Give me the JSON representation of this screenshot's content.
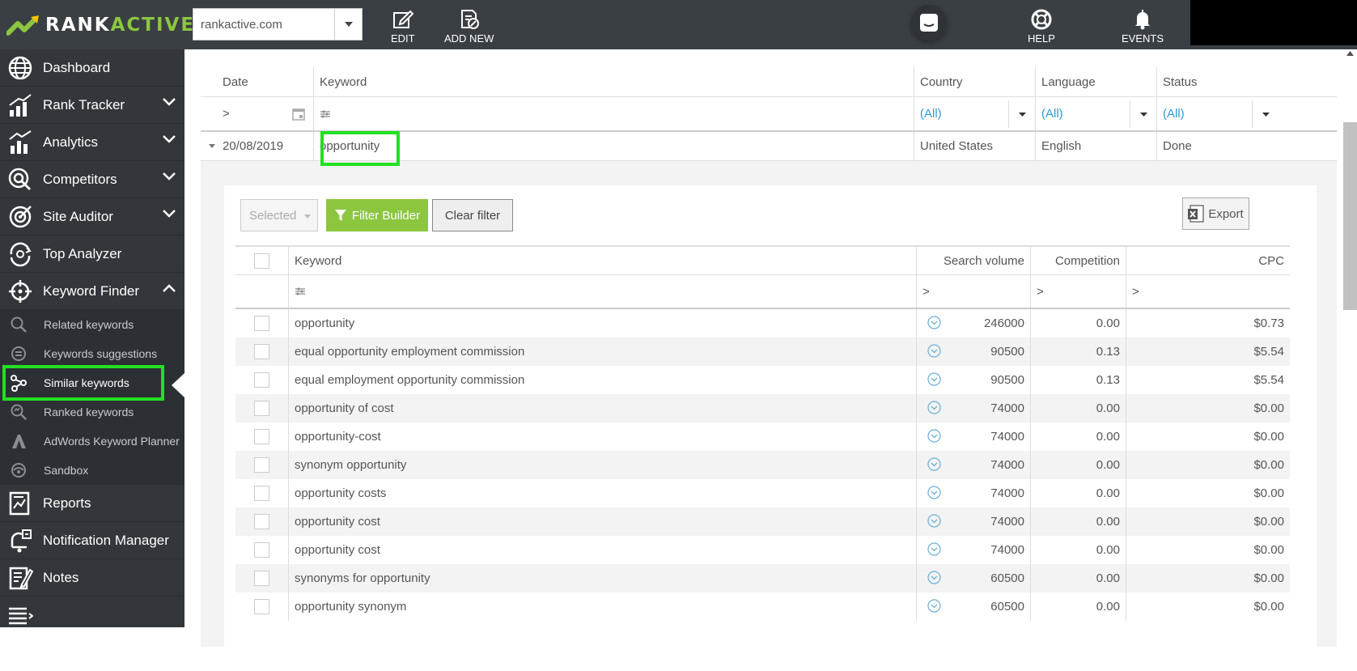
{
  "brand": {
    "rank": "RANK",
    "active": "ACTIVE"
  },
  "topbar": {
    "domain_value": "rankactive.com",
    "edit_label": "EDIT",
    "add_new_label": "ADD NEW",
    "help_label": "HELP",
    "events_label": "EVENTS"
  },
  "sidebar": {
    "items": [
      {
        "label": "Dashboard"
      },
      {
        "label": "Rank Tracker"
      },
      {
        "label": "Analytics"
      },
      {
        "label": "Competitors"
      },
      {
        "label": "Site Auditor"
      },
      {
        "label": "Top Analyzer"
      },
      {
        "label": "Keyword Finder"
      }
    ],
    "sub_items": [
      {
        "label": "Related keywords"
      },
      {
        "label": "Keywords suggestions"
      },
      {
        "label": "Similar keywords"
      },
      {
        "label": "Ranked keywords"
      },
      {
        "label": "AdWords Keyword Planner"
      },
      {
        "label": "Sandbox"
      }
    ],
    "bottom_items": [
      {
        "label": "Reports"
      },
      {
        "label": "Notification Manager"
      },
      {
        "label": "Notes"
      }
    ]
  },
  "grid": {
    "headers": {
      "date": "Date",
      "keyword": "Keyword",
      "country": "Country",
      "language": "Language",
      "status": "Status"
    },
    "filter": {
      "date_op": ">",
      "country": "(All)",
      "language": "(All)",
      "status": "(All)"
    },
    "row": {
      "date": "20/08/2019",
      "keyword": "opportunity",
      "country": "United States",
      "language": "English",
      "status": "Done"
    }
  },
  "detail": {
    "selected_label": "Selected",
    "filter_builder_label": "Filter Builder",
    "clear_filter_label": "Clear filter",
    "export_label": "Export",
    "headers": {
      "keyword": "Keyword",
      "volume": "Search volume",
      "competition": "Competition",
      "cpc": "CPC"
    },
    "filter_ops": {
      "volume": ">",
      "competition": ">",
      "cpc": ">"
    },
    "rows": [
      {
        "keyword": "opportunity",
        "volume": "246000",
        "competition": "0.00",
        "cpc": "$0.73"
      },
      {
        "keyword": "equal opportunity employment commission",
        "volume": "90500",
        "competition": "0.13",
        "cpc": "$5.54"
      },
      {
        "keyword": "equal employment opportunity commission",
        "volume": "90500",
        "competition": "0.13",
        "cpc": "$5.54"
      },
      {
        "keyword": "opportunity of cost",
        "volume": "74000",
        "competition": "0.00",
        "cpc": "$0.00"
      },
      {
        "keyword": "opportunity-cost",
        "volume": "74000",
        "competition": "0.00",
        "cpc": "$0.00"
      },
      {
        "keyword": "synonym opportunity",
        "volume": "74000",
        "competition": "0.00",
        "cpc": "$0.00"
      },
      {
        "keyword": "opportunity costs",
        "volume": "74000",
        "competition": "0.00",
        "cpc": "$0.00"
      },
      {
        "keyword": "opportunity cost",
        "volume": "74000",
        "competition": "0.00",
        "cpc": "$0.00"
      },
      {
        "keyword": "opportunity cost",
        "volume": "74000",
        "competition": "0.00",
        "cpc": "$0.00"
      },
      {
        "keyword": "synonyms for opportunity",
        "volume": "60500",
        "competition": "0.00",
        "cpc": "$0.00"
      },
      {
        "keyword": "opportunity synonym",
        "volume": "60500",
        "competition": "0.00",
        "cpc": "$0.00"
      }
    ]
  },
  "colors": {
    "accent": "#8cc63f",
    "highlight": "#22e022",
    "sidebar": "#33373b",
    "topbar": "#3a3f44",
    "link": "#2d9bd3"
  }
}
